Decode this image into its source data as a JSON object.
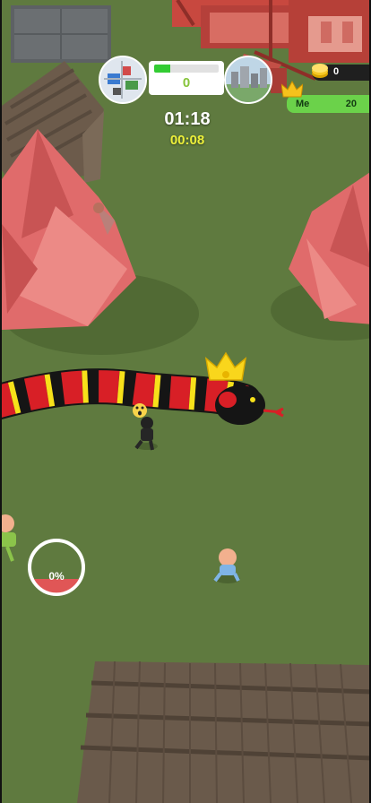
{
  "hud": {
    "progress": {
      "count": "0",
      "fill_fraction": 0.25
    },
    "timer_main": "01:18",
    "timer_sub": "00:08",
    "coins": {
      "count": "0"
    },
    "leaderboard": {
      "name": "Me",
      "score": "20"
    },
    "growth": {
      "percent_label": "0%",
      "fill_fraction": 0.0
    }
  },
  "colors": {
    "ground": "#5f7a3f",
    "snake_red": "#d81f26",
    "snake_black": "#151515",
    "snake_yellow": "#f7e11a",
    "tree_pink": "#e06b6b",
    "progress_green": "#33cc33",
    "leader_green": "#6bd24a",
    "timer_yellow": "#ecef3a"
  },
  "icons": [
    "map-thumbnail-icon",
    "coin-icon",
    "crown-icon",
    "snake-crown-icon",
    "scared-emoji-icon"
  ]
}
